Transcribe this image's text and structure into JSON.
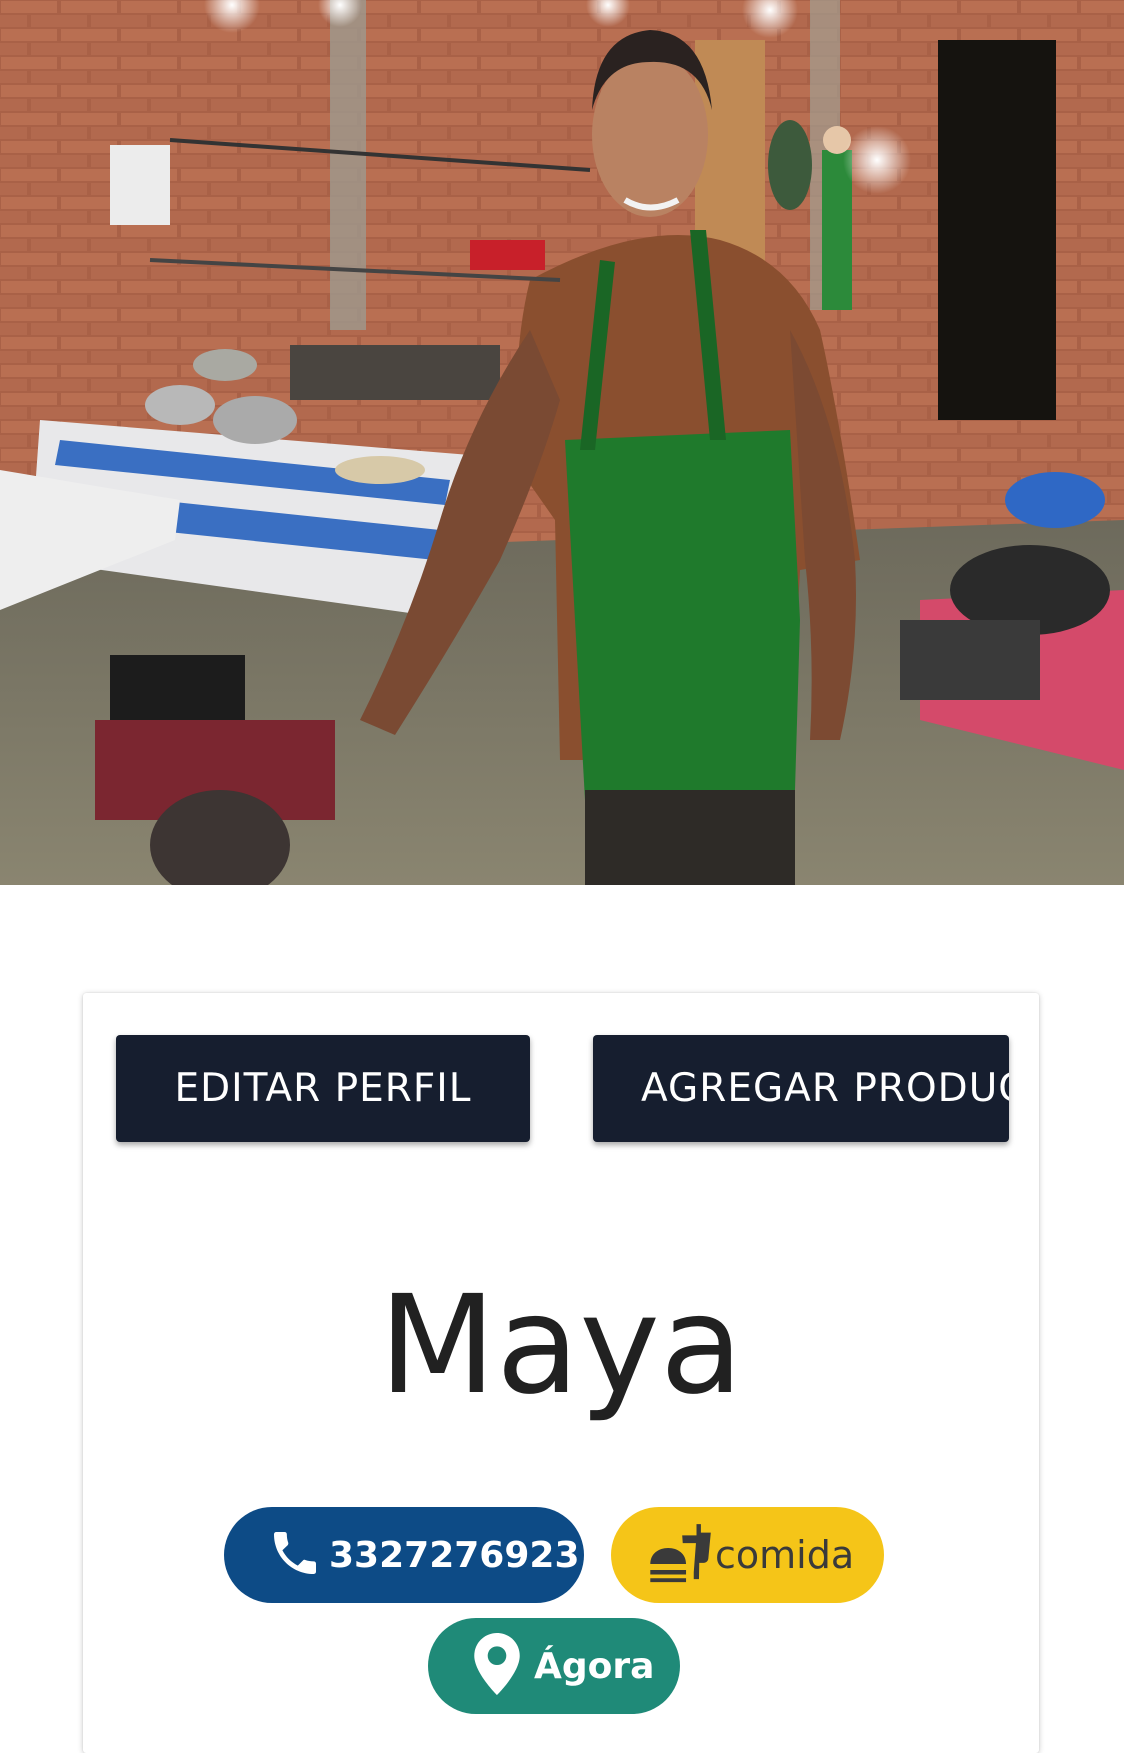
{
  "profile": {
    "cover_image": "kitchen-chef-photo",
    "actions": {
      "edit_label": "EDITAR PERFIL",
      "add_product_label": "AGREGAR PRODUC"
    },
    "name": "Maya",
    "phone": "3327276923",
    "category": "comida",
    "location": "Ágora"
  },
  "icons": {
    "phone": "phone-icon",
    "category": "fastfood-icon",
    "location": "map-pin-icon"
  },
  "colors": {
    "button_bg": "#161e2f",
    "phone_chip": "#0d4b86",
    "category_chip": "#f5c518",
    "location_chip": "#1f8a78",
    "name_text": "#212121"
  }
}
